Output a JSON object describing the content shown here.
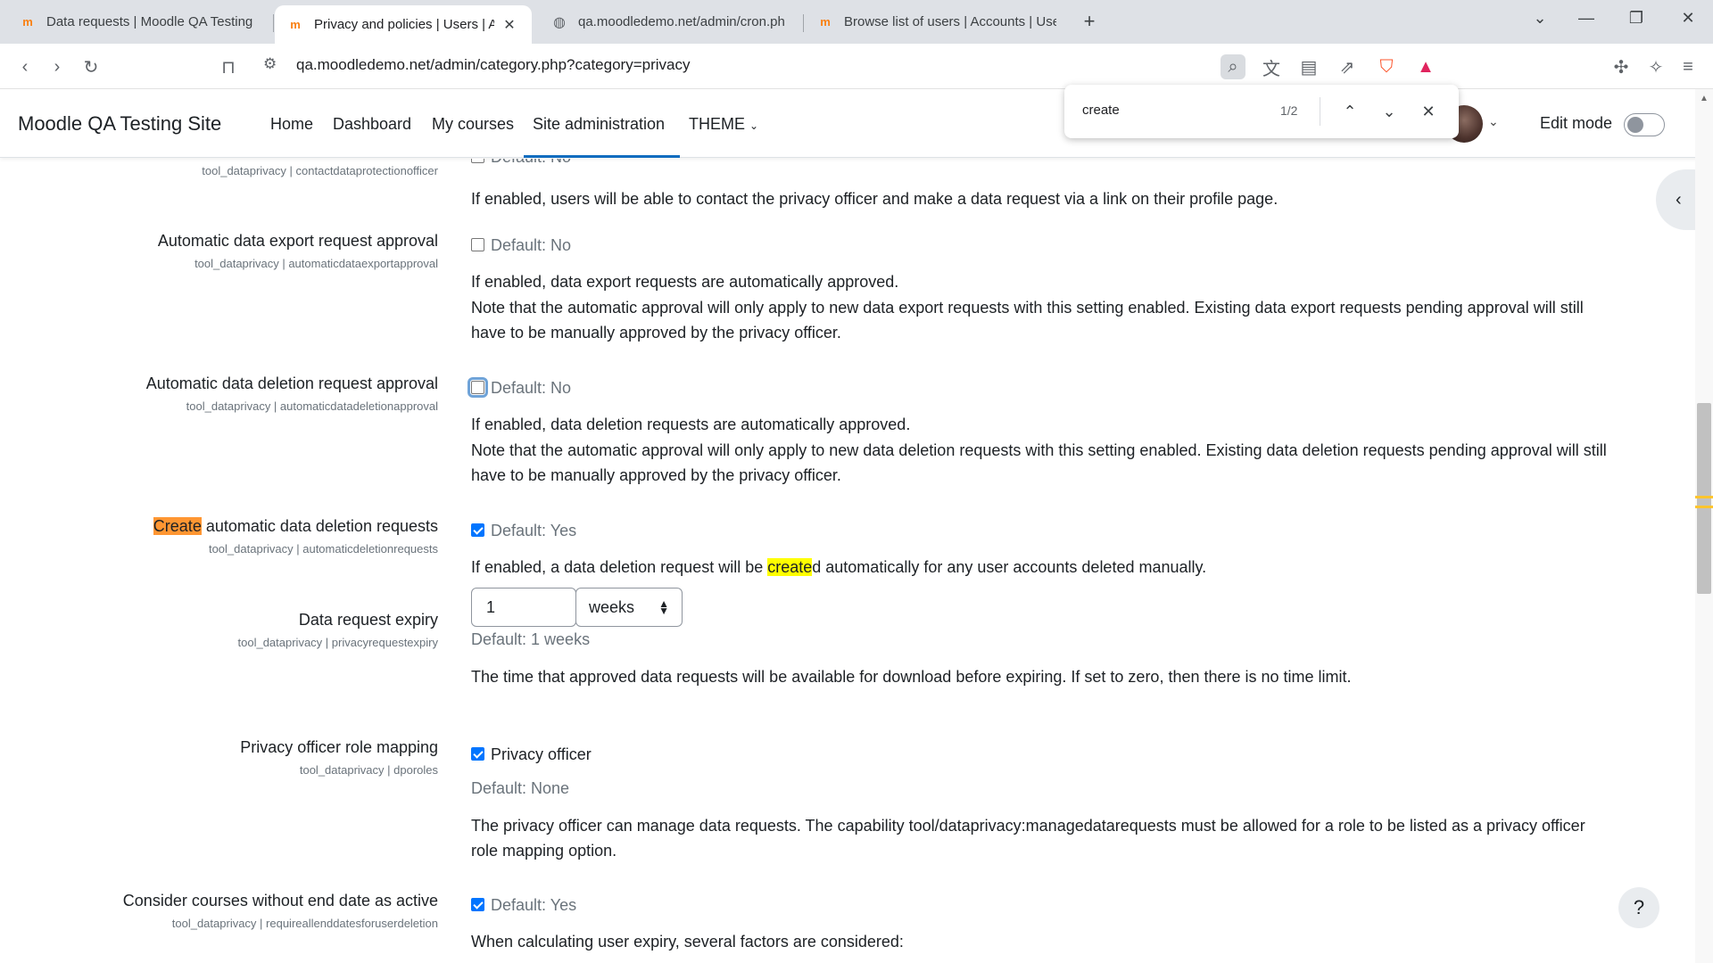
{
  "browser": {
    "tabs": [
      {
        "title": "Data requests | Moodle QA Testing"
      },
      {
        "title": "Privacy and policies | Users | Ad"
      },
      {
        "title": "qa.moodledemo.net/admin/cron.ph"
      },
      {
        "title": "Browse list of users | Accounts | Use"
      }
    ],
    "url": "qa.moodledemo.net/admin/category.php?category=privacy"
  },
  "find": {
    "query": "create",
    "count": "1/2"
  },
  "nav": {
    "brand": "Moodle QA Testing Site",
    "links": [
      "Home",
      "Dashboard",
      "My courses",
      "Site administration",
      "THEME"
    ],
    "edit_mode": "Edit mode"
  },
  "settings": {
    "s0": {
      "sub": "tool_dataprivacy | contactdataprotectionofficer",
      "default": "Default: No",
      "desc": "If enabled, users will be able to contact the privacy officer and make a data request via a link on their profile page."
    },
    "s1": {
      "label": "Automatic data export request approval",
      "sub": "tool_dataprivacy | automaticdataexportapproval",
      "default": "Default: No",
      "desc1": "If enabled, data export requests are automatically approved.",
      "desc2": "Note that the automatic approval will only apply to new data export requests with this setting enabled. Existing data export requests pending approval will still have to be manually approved by the privacy officer."
    },
    "s2": {
      "label": "Automatic data deletion request approval",
      "sub": "tool_dataprivacy | automaticdatadeletionapproval",
      "default": "Default: No",
      "desc1": "If enabled, data deletion requests are automatically approved.",
      "desc2": "Note that the automatic approval will only apply to new data deletion requests with this setting enabled. Existing data deletion requests pending approval will still have to be manually approved by the privacy officer."
    },
    "s3": {
      "label_hl": "Create",
      "label_rest": " automatic data deletion requests",
      "sub": "tool_dataprivacy | automaticdeletionrequests",
      "default": "Default: Yes",
      "desc_pre": "If enabled, a data deletion request will be ",
      "desc_hl": "create",
      "desc_post": "d automatically for any user accounts deleted manually."
    },
    "s4": {
      "label": "Data request expiry",
      "sub": "tool_dataprivacy | privacyrequestexpiry",
      "value": "1",
      "unit": "weeks",
      "default": "Default: 1 weeks",
      "desc": "The time that approved data requests will be available for download before expiring. If set to zero, then there is no time limit."
    },
    "s5": {
      "label": "Privacy officer role mapping",
      "sub": "tool_dataprivacy | dporoles",
      "option": "Privacy officer",
      "default": "Default: None",
      "desc": "The privacy officer can manage data requests. The capability tool/dataprivacy:managedatarequests must be allowed for a role to be listed as a privacy officer role mapping option."
    },
    "s6": {
      "label": "Consider courses without end date as active",
      "sub": "tool_dataprivacy | requireallenddatesforuserdeletion",
      "default": "Default: Yes",
      "desc": "When calculating user expiry, several factors are considered:"
    }
  },
  "help": "?"
}
